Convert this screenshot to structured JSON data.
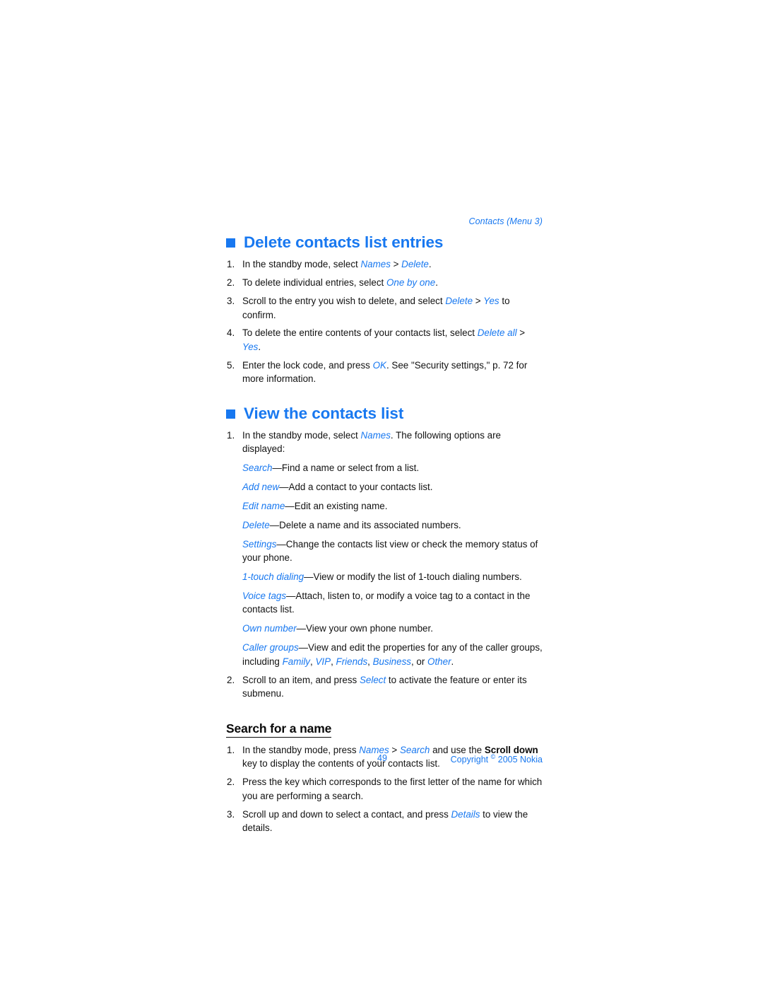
{
  "colors": {
    "accent_blue": "#1878F0",
    "body_text": "#121212",
    "page_background": "#ffffff"
  },
  "running_header": "Contacts (Menu 3)",
  "sections": [
    {
      "id": "delete-contacts-list-entries",
      "heading": "Delete contacts list entries",
      "steps": [
        {
          "num": "1.",
          "parts": [
            {
              "t": "In the standby mode, select ",
              "s": "plain"
            },
            {
              "t": "Names",
              "s": "ui"
            },
            {
              "t": " > ",
              "s": "plain"
            },
            {
              "t": "Delete",
              "s": "ui"
            },
            {
              "t": ".",
              "s": "plain"
            }
          ]
        },
        {
          "num": "2.",
          "parts": [
            {
              "t": "To delete individual entries, select ",
              "s": "plain"
            },
            {
              "t": "One by one",
              "s": "ui"
            },
            {
              "t": ".",
              "s": "plain"
            }
          ]
        },
        {
          "num": "3.",
          "parts": [
            {
              "t": "Scroll to the entry you wish to delete, and select ",
              "s": "plain"
            },
            {
              "t": "Delete",
              "s": "ui"
            },
            {
              "t": " > ",
              "s": "plain"
            },
            {
              "t": "Yes",
              "s": "ui"
            },
            {
              "t": " to confirm.",
              "s": "plain"
            }
          ]
        },
        {
          "num": "4.",
          "parts": [
            {
              "t": "To delete the entire contents of your contacts list, select ",
              "s": "plain"
            },
            {
              "t": "Delete all",
              "s": "ui"
            },
            {
              "t": " > ",
              "s": "plain"
            },
            {
              "t": "Yes",
              "s": "ui"
            },
            {
              "t": ".",
              "s": "plain"
            }
          ]
        },
        {
          "num": "5.",
          "parts": [
            {
              "t": "Enter the lock code, and press ",
              "s": "plain"
            },
            {
              "t": "OK",
              "s": "ui"
            },
            {
              "t": ". See \"Security settings,\" p. 72 for more information.",
              "s": "plain"
            }
          ]
        }
      ]
    },
    {
      "id": "view-the-contacts-list",
      "heading": "View the contacts list",
      "steps": [
        {
          "num": "1.",
          "parts": [
            {
              "t": "In the standby mode, select ",
              "s": "plain"
            },
            {
              "t": "Names",
              "s": "ui"
            },
            {
              "t": ". The following options are displayed:",
              "s": "plain"
            }
          ],
          "definitions": [
            [
              {
                "t": "Search",
                "s": "ui"
              },
              {
                "t": "—Find a name or select from a list.",
                "s": "plain"
              }
            ],
            [
              {
                "t": "Add new",
                "s": "ui"
              },
              {
                "t": "—Add a contact to your contacts list.",
                "s": "plain"
              }
            ],
            [
              {
                "t": "Edit name",
                "s": "ui"
              },
              {
                "t": "—Edit an existing name.",
                "s": "plain"
              }
            ],
            [
              {
                "t": "Delete",
                "s": "ui"
              },
              {
                "t": "—Delete a name and its associated numbers.",
                "s": "plain"
              }
            ],
            [
              {
                "t": "Settings",
                "s": "ui"
              },
              {
                "t": "—Change the contacts list view or check the memory status of your phone.",
                "s": "plain"
              }
            ],
            [
              {
                "t": "1-touch dialing",
                "s": "ui"
              },
              {
                "t": "—View or modify the list of 1-touch dialing numbers.",
                "s": "plain"
              }
            ],
            [
              {
                "t": "Voice tags",
                "s": "ui"
              },
              {
                "t": "—Attach, listen to, or modify a voice tag to a contact in the contacts list.",
                "s": "plain"
              }
            ],
            [
              {
                "t": "Own number",
                "s": "ui"
              },
              {
                "t": "—View your own phone number.",
                "s": "plain"
              }
            ],
            [
              {
                "t": "Caller groups",
                "s": "ui"
              },
              {
                "t": "—View and edit the properties for any of the caller groups, including ",
                "s": "plain"
              },
              {
                "t": "Family",
                "s": "ui"
              },
              {
                "t": ", ",
                "s": "plain"
              },
              {
                "t": "VIP",
                "s": "ui"
              },
              {
                "t": ", ",
                "s": "plain"
              },
              {
                "t": "Friends",
                "s": "ui"
              },
              {
                "t": ", ",
                "s": "plain"
              },
              {
                "t": "Business",
                "s": "ui"
              },
              {
                "t": ", or ",
                "s": "plain"
              },
              {
                "t": "Other",
                "s": "ui"
              },
              {
                "t": ".",
                "s": "plain"
              }
            ]
          ]
        },
        {
          "num": "2.",
          "parts": [
            {
              "t": "Scroll to an item, and press ",
              "s": "plain"
            },
            {
              "t": "Select",
              "s": "ui"
            },
            {
              "t": " to activate the feature or enter its submenu.",
              "s": "plain"
            }
          ]
        }
      ],
      "subsection": {
        "id": "search-for-a-name",
        "heading": "Search for a name",
        "steps": [
          {
            "num": "1.",
            "parts": [
              {
                "t": "In the standby mode, press ",
                "s": "plain"
              },
              {
                "t": "Names",
                "s": "ui"
              },
              {
                "t": " > ",
                "s": "plain"
              },
              {
                "t": "Search",
                "s": "ui"
              },
              {
                "t": " and use the ",
                "s": "plain"
              },
              {
                "t": "Scroll down",
                "s": "kbd"
              },
              {
                "t": " key to display the contents of your contacts list.",
                "s": "plain"
              }
            ]
          },
          {
            "num": "2.",
            "parts": [
              {
                "t": "Press the key which corresponds to the first letter of the name for which you are performing a search.",
                "s": "plain"
              }
            ]
          },
          {
            "num": "3.",
            "parts": [
              {
                "t": "Scroll up and down to select a contact, and press ",
                "s": "plain"
              },
              {
                "t": "Details",
                "s": "ui"
              },
              {
                "t": " to view the details.",
                "s": "plain"
              }
            ]
          }
        ]
      }
    }
  ],
  "footer": {
    "page_number": "49",
    "copyright_prefix": "Copyright ",
    "copyright_symbol": "©",
    "copyright_suffix": " 2005 Nokia"
  }
}
